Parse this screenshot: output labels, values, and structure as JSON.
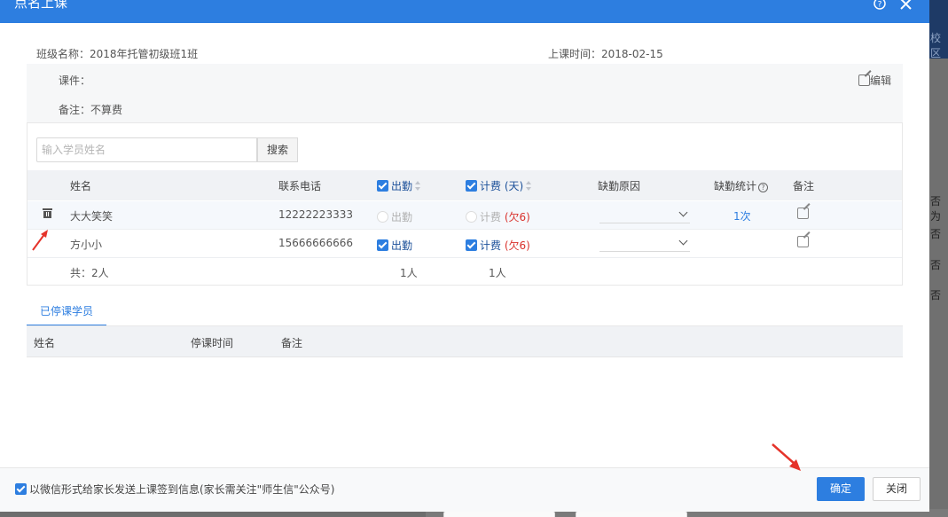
{
  "dialog": {
    "title": "点名上课",
    "help_icon": "question-circle-icon",
    "close_icon": "close-icon"
  },
  "info": {
    "class_name": "班级名称：2018年托管初级班1班",
    "class_time": "上课时间：2018-02-15",
    "courseware": "课件：",
    "remark": "备注：不算费",
    "edit_label": "编辑"
  },
  "search": {
    "placeholder": "输入学员姓名",
    "button_label": "搜索"
  },
  "table": {
    "headers": {
      "name": "姓名",
      "phone": "联系电话",
      "attendance": "出勤",
      "billing": "计费",
      "billing_unit": "(天)",
      "absence_reason": "缺勤原因",
      "absence_stats": "缺勤统计",
      "remark": "备注"
    },
    "rows": [
      {
        "name": "大大笑笑",
        "phone": "12222223333",
        "attendance": "出勤",
        "attendance_checked": false,
        "billing": "计费",
        "billing_owed": "(欠6)",
        "billing_checked": false,
        "absence_stats": "1次"
      },
      {
        "name": "方小小",
        "phone": "15666666666",
        "attendance": "出勤",
        "attendance_checked": true,
        "billing": "计费",
        "billing_owed": "(欠6)",
        "billing_checked": true,
        "absence_stats": ""
      }
    ],
    "summary": {
      "total": "共：2人",
      "attendance_count": "1人",
      "billing_count": "1人"
    }
  },
  "suspended": {
    "tab_label": "已停课学员",
    "headers": {
      "name": "姓名",
      "suspend_time": "停课时间",
      "remark": "备注"
    }
  },
  "footer": {
    "wechat_option": "以微信形式给家长发送上课签到信息(家长需关注\"师生信\"公众号)",
    "wechat_checked": true,
    "confirm_label": "确定",
    "close_label": "关闭"
  },
  "background": {
    "side_texts": [
      "校区",
      "否为",
      "否",
      "否",
      "否"
    ]
  },
  "colors": {
    "primary": "#2d7ee0",
    "owed": "#d9302b",
    "annotation_arrow": "#e5332a"
  }
}
